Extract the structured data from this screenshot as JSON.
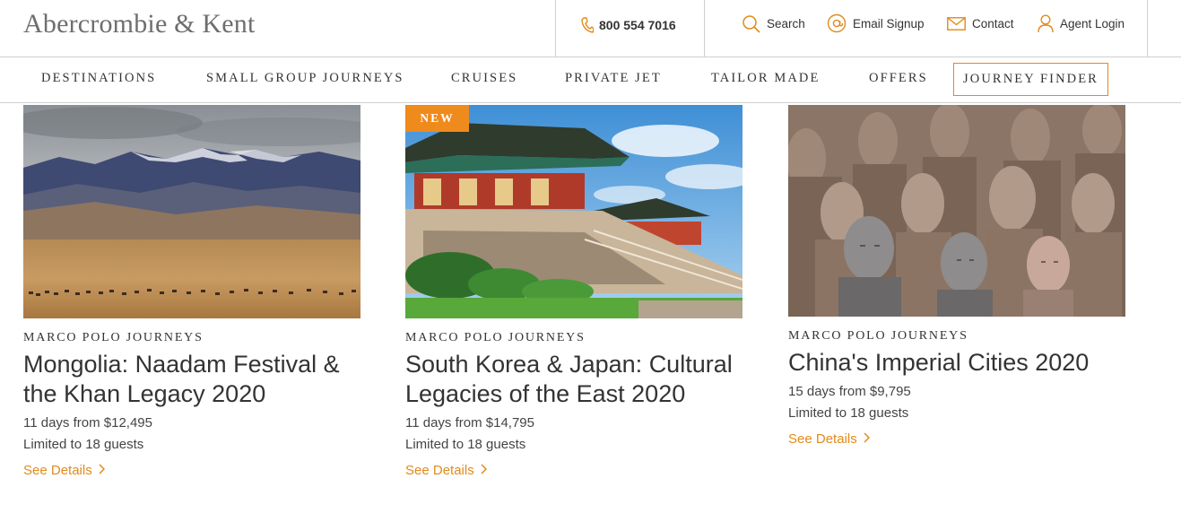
{
  "header": {
    "logo": "Abercrombie & Kent",
    "phone": "800 554 7016",
    "utility": {
      "search": "Search",
      "email_signup": "Email Signup",
      "contact": "Contact",
      "agent_login": "Agent Login"
    }
  },
  "nav": {
    "items": [
      "DESTINATIONS",
      "SMALL GROUP JOURNEYS",
      "CRUISES",
      "PRIVATE JET",
      "TAILOR MADE",
      "OFFERS"
    ],
    "journey_finder": "JOURNEY FINDER"
  },
  "colors": {
    "accent": "#e28a1a",
    "badge": "#ef8a1c",
    "text": "#333333"
  },
  "cards": [
    {
      "collection": "MARCO POLO JOURNEYS",
      "title": "Mongolia: Naadam Festival & the Khan Legacy 2020",
      "duration_price": "11 days from $12,495",
      "guests": "Limited to 18 guests",
      "cta": "See Details",
      "image": "mongolian-steppe-mountains"
    },
    {
      "badge": "NEW",
      "collection": "MARCO POLO JOURNEYS",
      "title": "South Korea & Japan: Cultural Legacies of the East 2020",
      "duration_price": "11 days from $14,795",
      "guests": "Limited to 18 guests",
      "cta": "See Details",
      "image": "korean-temple"
    },
    {
      "collection": "MARCO POLO JOURNEYS",
      "title": "China's Imperial Cities 2020",
      "duration_price": "15 days from $9,795",
      "guests": "Limited to 18 guests",
      "cta": "See Details",
      "image": "terracotta-warriors"
    }
  ]
}
